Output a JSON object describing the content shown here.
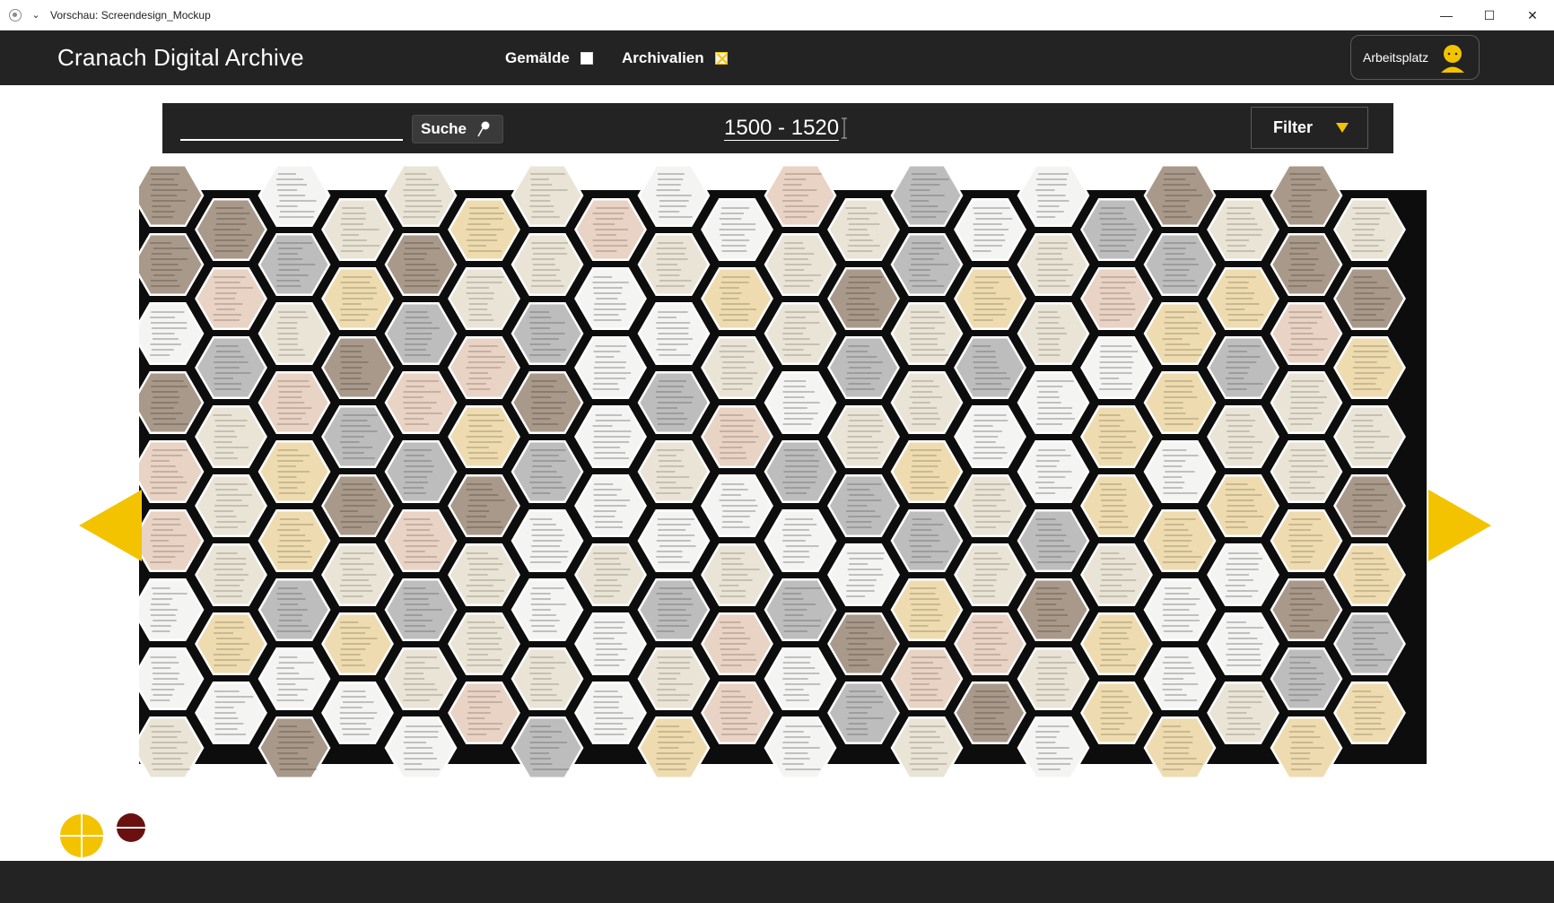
{
  "window": {
    "title": "Vorschau: Screendesign_Mockup",
    "menu_icon": "chevron-down-icon",
    "controls": [
      "minimize",
      "maximize",
      "close"
    ]
  },
  "header": {
    "brand": "Cranach Digital Archive",
    "toggles": [
      {
        "label": "Gemälde",
        "checked": false
      },
      {
        "label": "Archivalien",
        "checked": true
      }
    ],
    "workspace_label": "Arbeitsplatz",
    "workspace_icon": "user-avatar-icon"
  },
  "search": {
    "value": "",
    "button_label": "Suche",
    "button_icon": "magnifier-icon",
    "date_range": "1500 - 1520",
    "filter_label": "Filter",
    "filter_icon": "caret-down-icon"
  },
  "navigation": {
    "prev_icon": "arrow-left-icon",
    "next_icon": "arrow-right-icon"
  },
  "zoom": {
    "in_icon": "zoom-in-icon",
    "out_icon": "zoom-out-icon"
  },
  "colors": {
    "accent": "#f3c300",
    "header_bg": "#232323",
    "zoom_out": "#6b1010"
  },
  "grid": {
    "tile_type": "archival-document-thumbnail",
    "columns": 20,
    "rows": 9,
    "tile_tones": [
      "white",
      "cream",
      "sepia",
      "gray",
      "yellow",
      "pink"
    ]
  }
}
